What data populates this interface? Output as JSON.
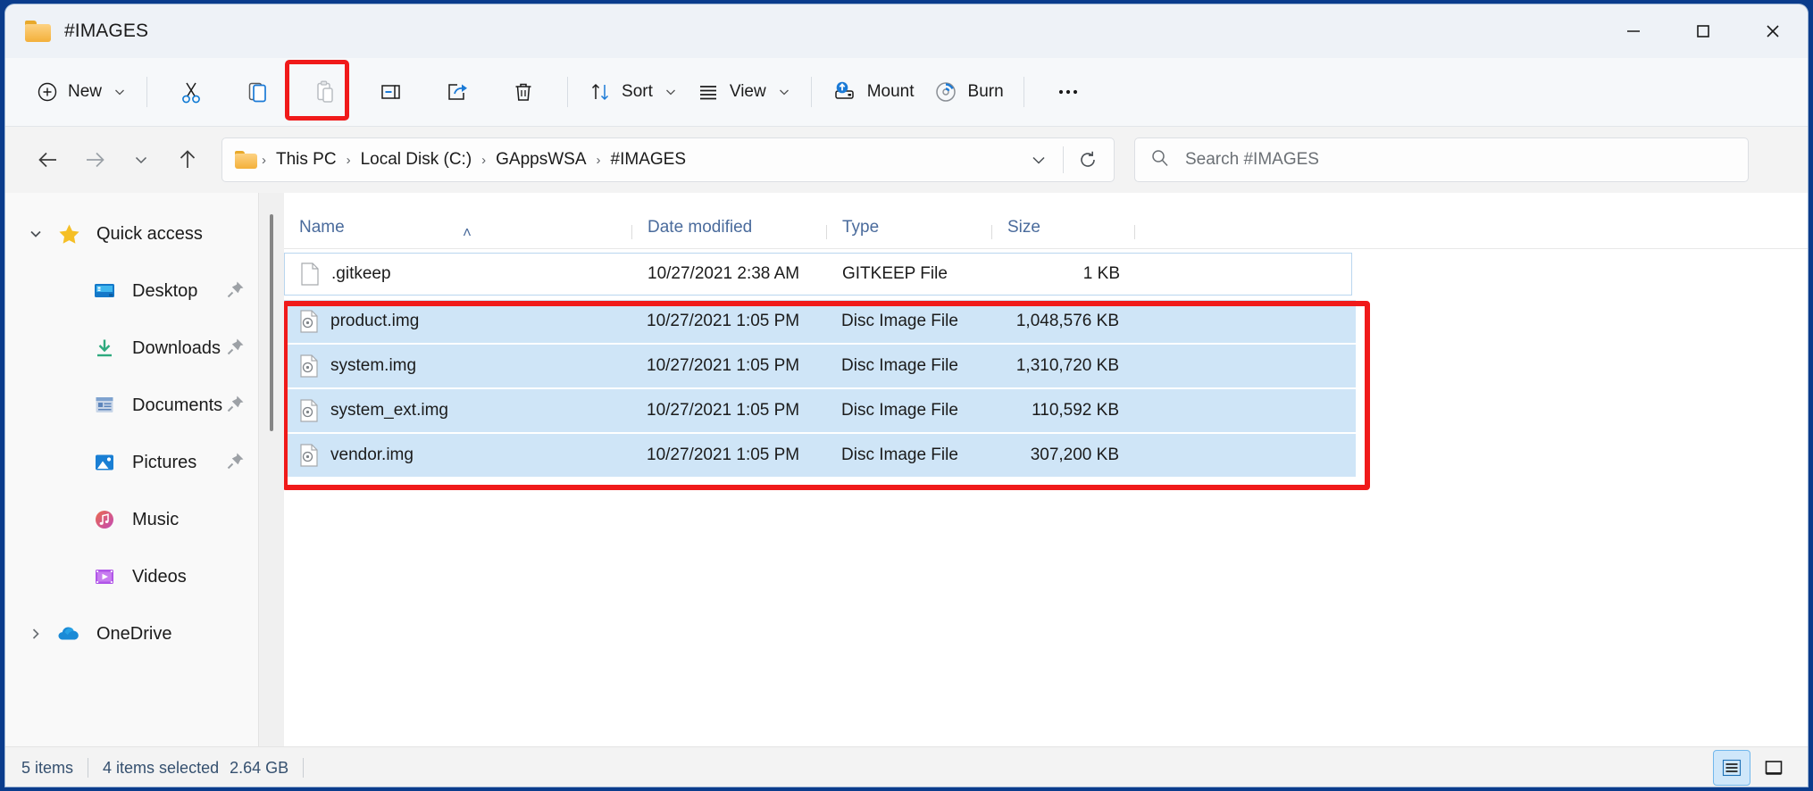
{
  "window": {
    "title": "#IMAGES",
    "folder_icon": "folder-icon",
    "controls": {
      "minimize": "minimize-icon",
      "maximize": "maximize-icon",
      "close": "close-icon"
    }
  },
  "toolbar": {
    "new_label": "New",
    "cut_label": "Cut",
    "copy_label": "Copy",
    "paste_label": "Paste",
    "rename_label": "Rename",
    "share_label": "Share",
    "delete_label": "Delete",
    "sort_label": "Sort",
    "view_label": "View",
    "mount_label": "Mount",
    "burn_label": "Burn",
    "more_label": "See more",
    "highlighted_button": "Paste"
  },
  "address": {
    "back_label": "Back",
    "forward_label": "Forward",
    "recent_label": "Recent locations",
    "up_label": "Up",
    "breadcrumbs": [
      {
        "label": "This PC"
      },
      {
        "label": "Local Disk (C:)"
      },
      {
        "label": "GAppsWSA"
      },
      {
        "label": "#IMAGES"
      }
    ],
    "separator": "›",
    "dropdown_label": "Previous locations",
    "refresh_label": "Refresh"
  },
  "search": {
    "placeholder": "Search #IMAGES",
    "value": ""
  },
  "sidebar": {
    "items": [
      {
        "label": "Quick access",
        "icon": "star-icon",
        "chevron": "chevron-down-icon",
        "pinned": false,
        "indent": false
      },
      {
        "label": "Desktop",
        "icon": "desktop-icon",
        "chevron": "",
        "pinned": true,
        "indent": true
      },
      {
        "label": "Downloads",
        "icon": "downloads-icon",
        "chevron": "",
        "pinned": true,
        "indent": true
      },
      {
        "label": "Documents",
        "icon": "documents-icon",
        "chevron": "",
        "pinned": true,
        "indent": true
      },
      {
        "label": "Pictures",
        "icon": "pictures-icon",
        "chevron": "",
        "pinned": true,
        "indent": true
      },
      {
        "label": "Music",
        "icon": "music-icon",
        "chevron": "",
        "pinned": false,
        "indent": true
      },
      {
        "label": "Videos",
        "icon": "videos-icon",
        "chevron": "",
        "pinned": false,
        "indent": true
      },
      {
        "label": "OneDrive",
        "icon": "onedrive-icon",
        "chevron": "chevron-right-icon",
        "pinned": false,
        "indent": false
      }
    ]
  },
  "file_list": {
    "columns": [
      {
        "label": "Name",
        "sorted": true,
        "sort_direction": "ascending",
        "sort_glyph": "˄"
      },
      {
        "label": "Date modified",
        "sorted": false
      },
      {
        "label": "Type",
        "sorted": false
      },
      {
        "label": "Size",
        "sorted": false
      }
    ],
    "rows": [
      {
        "name": ".gitkeep",
        "date_modified": "10/27/2021 2:38 AM",
        "type": "GITKEEP File",
        "size": "1 KB",
        "icon": "blank-file-icon",
        "selected": false,
        "focused": true
      },
      {
        "name": "product.img",
        "date_modified": "10/27/2021 1:05 PM",
        "type": "Disc Image File",
        "size": "1,048,576 KB",
        "icon": "disc-image-icon",
        "selected": true,
        "focused": false
      },
      {
        "name": "system.img",
        "date_modified": "10/27/2021 1:05 PM",
        "type": "Disc Image File",
        "size": "1,310,720 KB",
        "icon": "disc-image-icon",
        "selected": true,
        "focused": false
      },
      {
        "name": "system_ext.img",
        "date_modified": "10/27/2021 1:05 PM",
        "type": "Disc Image File",
        "size": "110,592 KB",
        "icon": "disc-image-icon",
        "selected": true,
        "focused": false
      },
      {
        "name": "vendor.img",
        "date_modified": "10/27/2021 1:05 PM",
        "type": "Disc Image File",
        "size": "307,200 KB",
        "icon": "disc-image-icon",
        "selected": true,
        "focused": false
      }
    ]
  },
  "status": {
    "item_count": "5 items",
    "selection": "4 items selected",
    "selection_size": "2.64 GB",
    "details_view_label": "Details view",
    "large_icons_view_label": "Large icons view",
    "active_view": "Details view"
  },
  "colors": {
    "accent": "#0067c0",
    "highlight_rect": "#f01a1a",
    "selection_bg": "#cfe5f7",
    "column_header_text": "#4a6b9c",
    "status_text": "#35506f",
    "title_bar_bg": "#eef2f7"
  }
}
